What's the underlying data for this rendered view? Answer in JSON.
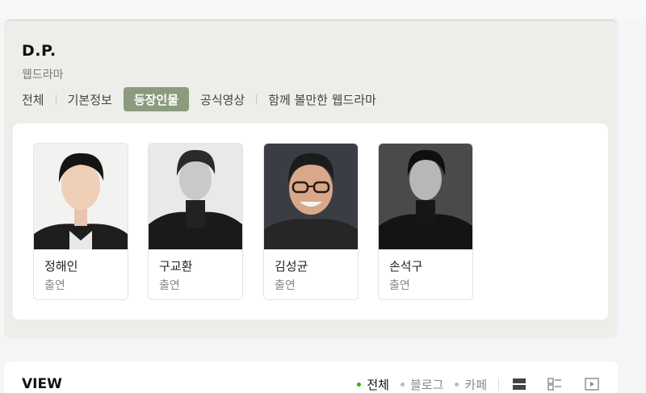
{
  "header": {
    "title": "D.P.",
    "subtitle": "웹드라마"
  },
  "tabs": [
    {
      "label": "전체",
      "active": false
    },
    {
      "label": "기본정보",
      "active": false
    },
    {
      "label": "등장인물",
      "active": true
    },
    {
      "label": "공식영상",
      "active": false
    },
    {
      "label": "함께 볼만한 웹드라마",
      "active": false
    }
  ],
  "cast": [
    {
      "name": "정해인",
      "role": "출연"
    },
    {
      "name": "구교환",
      "role": "출연"
    },
    {
      "name": "김성균",
      "role": "출연"
    },
    {
      "name": "손석구",
      "role": "출연"
    }
  ],
  "view": {
    "title": "VIEW",
    "filters": [
      {
        "label": "전체",
        "active": true
      },
      {
        "label": "블로그",
        "active": false
      },
      {
        "label": "카페",
        "active": false
      }
    ],
    "icons": [
      "list-view-icon",
      "grid-view-icon",
      "video-view-icon"
    ]
  },
  "colors": {
    "tab_active_bg": "#8a9b7e",
    "panel_bg": "#ededea",
    "active_dot": "#2db400"
  }
}
